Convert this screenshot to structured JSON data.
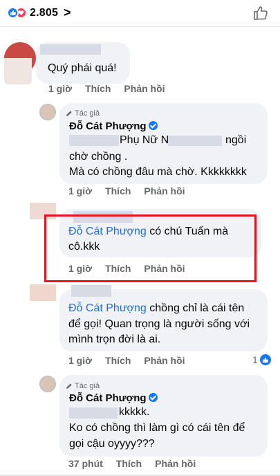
{
  "header": {
    "reaction_count": "2.805",
    "chevron": ">"
  },
  "comments": [
    {
      "text": "Quý phái quá!",
      "meta": {
        "time": "1 giờ",
        "like": "Thích",
        "reply": "Phản hồi"
      }
    },
    {
      "badge": "Tác giả",
      "author": "Đỗ Cát Phượng",
      "line1_a": "Phụ Nữ N",
      "line1_b": "ngồi",
      "line2": "chờ chồng .",
      "line3": "Mà có chồng đâu mà chờ. Kkkkkkkk",
      "meta": {
        "time": "1 giờ",
        "like": "Thích",
        "reply": "Phản hồi"
      }
    },
    {
      "mention": "Đỗ Cát Phượng",
      "line1": "có chú Tuấn mà",
      "line2": "cô.kkk",
      "meta": {
        "time": "1 giờ",
        "like": "Thích",
        "reply": "Phản hồi"
      }
    },
    {
      "mention": "Đỗ Cát Phượng",
      "line1": "chồng chỉ là cái tên",
      "line2": "để gọi! Quan trọng là người sống với",
      "line3": "mình trọn đời là ai.",
      "meta": {
        "time": "1 giờ",
        "like": "Thích",
        "reply": "Phản hồi"
      },
      "like_count": "1"
    },
    {
      "badge": "Tác giả",
      "author": "Đỗ Cát Phượng",
      "line1": "kkkkk.",
      "line2": "Ko có chồng thì làm gì có cái tên để",
      "line3": "gọi cậu oyyyy???",
      "meta": {
        "time": "37 phút",
        "like": "Thích",
        "reply": "Phản hồi"
      }
    }
  ],
  "colors": {
    "accent": "#1877f2",
    "mention": "#216fdb",
    "highlight": "#e0171f",
    "bubble": "#f0f2f5"
  }
}
